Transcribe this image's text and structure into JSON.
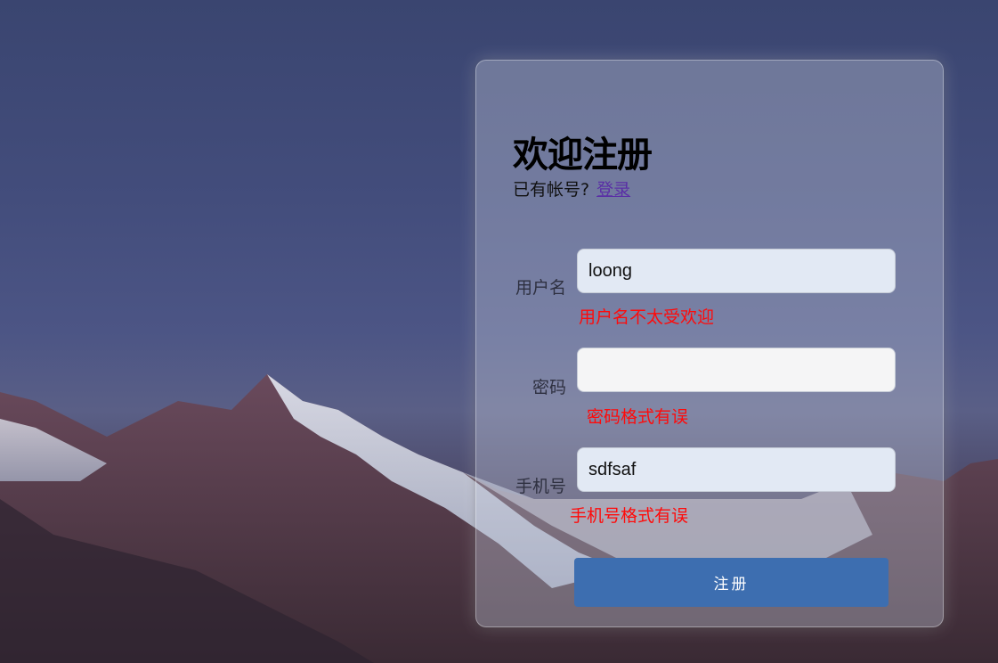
{
  "form": {
    "title": "欢迎注册",
    "have_account_text": "已有帐号?",
    "login_link": "登录",
    "fields": [
      {
        "label": "用户名",
        "value": "loong",
        "placeholder": "",
        "error": "用户名不太受欢迎"
      },
      {
        "label": "密码",
        "value": "",
        "placeholder": "",
        "error": "密码格式有误"
      },
      {
        "label": "手机号",
        "value": "sdfsaf",
        "placeholder": "",
        "error": "手机号格式有误"
      }
    ],
    "submit_label": "注册"
  },
  "colors": {
    "error": "#ff0a0a",
    "button": "#3d6eb0",
    "link": "#5a2ea6"
  }
}
